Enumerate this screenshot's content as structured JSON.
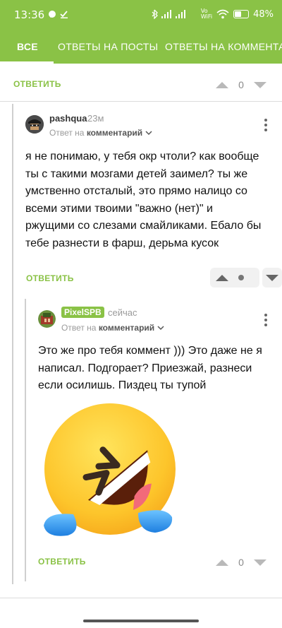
{
  "status_bar": {
    "time": "13:36",
    "battery_percent": "48%",
    "network_label": "Vo\nWiFi"
  },
  "tabs": [
    {
      "label": "ВСЕ",
      "active": true
    },
    {
      "label": "ОТВЕТЫ НА ПОСТЫ",
      "active": false
    },
    {
      "label": "ОТВЕТЫ НА КОММЕНТАРИИ",
      "active": false
    }
  ],
  "top_action": {
    "reply_label": "ОТВЕТИТЬ",
    "vote_count": "0"
  },
  "comment1": {
    "username": "pashqua",
    "time": "23м",
    "reply_prefix": "Ответ на",
    "reply_target": "комментарий",
    "text": "я не понимаю, у тебя окр чтоли? как вообще ты с такими мозгами детей заимел? ты же умственно отсталый, это прямо налицо со всеми этими твоими \"важно (нет)\" и ржущими со слезами смайликами. Ебало бы тебе разнести в фарш, дерьма кусок",
    "reply_label": "ОТВЕТИТЬ"
  },
  "comment2": {
    "username": "PixelSPB",
    "time": "сейчас",
    "reply_prefix": "Ответ на",
    "reply_target": "комментарий",
    "text": "Это же про тебя коммент ))) Это даже не я написал. Подгорает? Приезжай, разнеси если осилишь. Пиздец ты тупой",
    "emoji_name": "rolling-on-the-floor-laughing",
    "reply_label": "ОТВЕТИТЬ",
    "vote_count": "0"
  },
  "colors": {
    "accent": "#8ac246"
  }
}
